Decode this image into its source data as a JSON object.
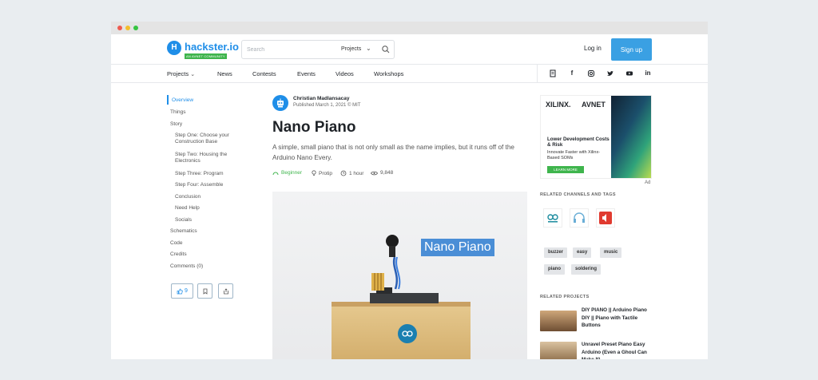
{
  "brand": {
    "name": "hackster.io",
    "badge": "AN AVNET COMMUNITY",
    "accent": "#1f8ee8",
    "green": "#3fb54d"
  },
  "header": {
    "search_placeholder": "Search",
    "search_scope": "Projects",
    "login": "Log in",
    "signup": "Sign up"
  },
  "nav": {
    "items": [
      "Projects",
      "News",
      "Contests",
      "Events",
      "Videos",
      "Workshops"
    ],
    "social_icons": [
      "document-icon",
      "facebook-icon",
      "instagram-icon",
      "twitter-icon",
      "youtube-icon",
      "linkedin-icon"
    ]
  },
  "toc": {
    "items": [
      {
        "label": "Overview",
        "active": true
      },
      {
        "label": "Things"
      },
      {
        "label": "Story"
      },
      {
        "label": "Step One: Choose your Construction Base"
      },
      {
        "label": "Step Two: Housing the Electronics"
      },
      {
        "label": "Step Three: Program"
      },
      {
        "label": "Step Four: Assemble"
      },
      {
        "label": "Conclusion"
      },
      {
        "label": "Need Help"
      },
      {
        "label": "Socials"
      },
      {
        "label": "Schematics"
      },
      {
        "label": "Code"
      },
      {
        "label": "Credits"
      },
      {
        "label": "Comments (0)"
      }
    ]
  },
  "actions": {
    "likes": "9"
  },
  "article": {
    "author": "Christian Madlansacay",
    "published": "Published March 1, 2021 © MIT",
    "title": "Nano Piano",
    "description": "A simple, small piano that is not only small as the name implies, but it runs off of the Arduino Nano Every.",
    "difficulty": "Beginner",
    "type": "Protip",
    "duration": "1 hour",
    "views": "9,848",
    "hero_label": "Nano Piano"
  },
  "ad": {
    "brand1": "XILINX.",
    "brand2": "AVNET",
    "headline": "Lower Development Costs & Risk",
    "subtext": "Innovate Faster with Xilinx-Based SOMs",
    "button": "LEARN MORE",
    "caption": "Ad"
  },
  "sidebar": {
    "channels_heading": "RELATED CHANNELS AND TAGS",
    "tags": [
      "buzzer",
      "easy",
      "music",
      "piano",
      "soldering"
    ],
    "related_heading": "RELATED PROJECTS",
    "related": [
      "DIY PIANO || Arduino Piano DIY || Piano with Tactile Buttons",
      "Unravel Preset Piano Easy Arduino (Even a Ghoul Can Make It)"
    ]
  }
}
